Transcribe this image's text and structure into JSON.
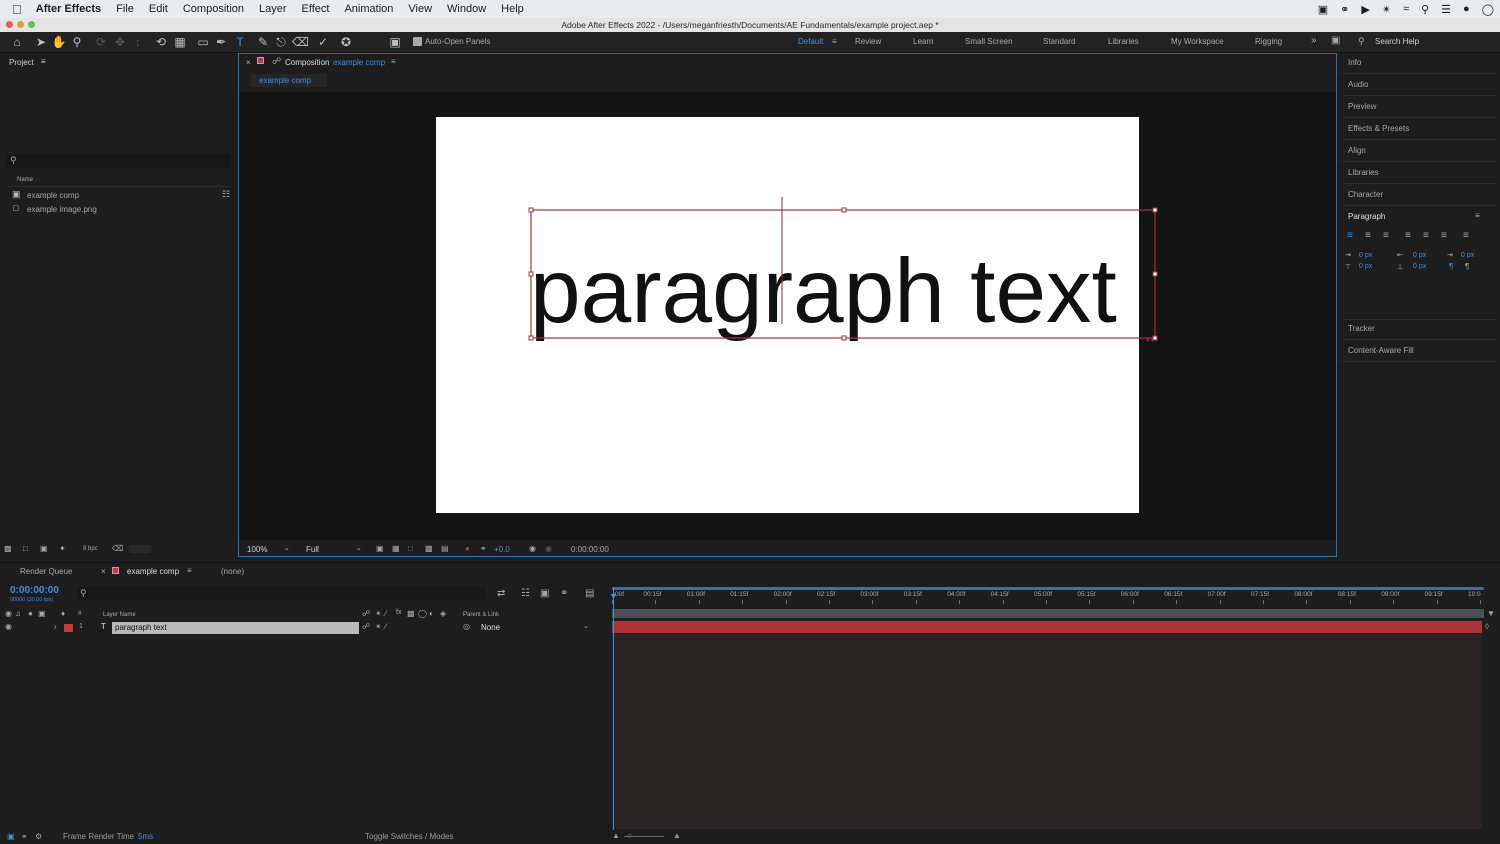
{
  "menubar": {
    "app_name": "After Effects",
    "items": [
      "File",
      "Edit",
      "Composition",
      "Layer",
      "Effect",
      "Animation",
      "View",
      "Window",
      "Help"
    ]
  },
  "window": {
    "title": "Adobe After Effects 2022 - /Users/meganfriesth/Documents/AE Fundamentals/example project.aep *"
  },
  "toolbar": {
    "auto_open_label": "Auto-Open Panels",
    "workspaces": [
      {
        "label": "Default",
        "active": true
      },
      {
        "label": "Review",
        "active": false
      },
      {
        "label": "Learn",
        "active": false
      },
      {
        "label": "Small Screen",
        "active": false
      },
      {
        "label": "Standard",
        "active": false
      },
      {
        "label": "Libraries",
        "active": false
      },
      {
        "label": "My Workspace",
        "active": false
      },
      {
        "label": "Rigging",
        "active": false
      }
    ],
    "search_placeholder": "Search Help"
  },
  "project": {
    "title": "Project",
    "column_name": "Name",
    "items": [
      {
        "label": "example comp",
        "icon": "composition-icon"
      },
      {
        "label": "example image.png",
        "icon": "image-file-icon"
      }
    ],
    "bpc": "8 bpc"
  },
  "composition": {
    "tab_prefix": "Composition",
    "tab_name": "example comp",
    "breadcrumb": "example comp",
    "canvas_text": "paragraph text",
    "zoom": "100%",
    "resolution": "Full",
    "exposure": "+0.0",
    "timecode": "0:00:00:00"
  },
  "right_panel": {
    "items": [
      "Info",
      "Audio",
      "Preview",
      "Effects & Presets",
      "Align",
      "Libraries",
      "Character"
    ],
    "paragraph_title": "Paragraph",
    "indent_values": [
      "0 px",
      "0 px",
      "0 px",
      "0 px",
      "0 px"
    ],
    "bottom_items": [
      "Tracker",
      "Content-Aware Fill"
    ]
  },
  "timeline": {
    "tab_render_queue": "Render Queue",
    "tab_comp": "example comp",
    "tab_none": "(none)",
    "timecode": "0:00:00:00",
    "frame_info": "00000 (30.00 fps)",
    "col_layer_name": "Layer Name",
    "col_parent": "Parent & Link",
    "col_hash": "#",
    "layers": [
      {
        "index": "1",
        "type_icon": "T",
        "name": "paragraph text",
        "parent": "None"
      }
    ],
    "ruler_labels": [
      "00f",
      "00:15f",
      "01:00f",
      "01:15f",
      "02:00f",
      "02:15f",
      "03:00f",
      "03:15f",
      "04:00f",
      "04:15f",
      "05:00f",
      "05:15f",
      "06:00f",
      "06:15f",
      "07:00f",
      "07:15f",
      "08:00f",
      "08:15f",
      "09:00f",
      "09:15f",
      "10:0"
    ]
  },
  "status": {
    "render_label": "Frame Render Time",
    "render_value": "5ms",
    "toggle_label": "Toggle Switches / Modes"
  },
  "colors": {
    "accent_blue": "#3d8fe3",
    "layer_label_red": "#c4393b",
    "track_bar": "#a93336",
    "selection_box": "#a03434"
  }
}
